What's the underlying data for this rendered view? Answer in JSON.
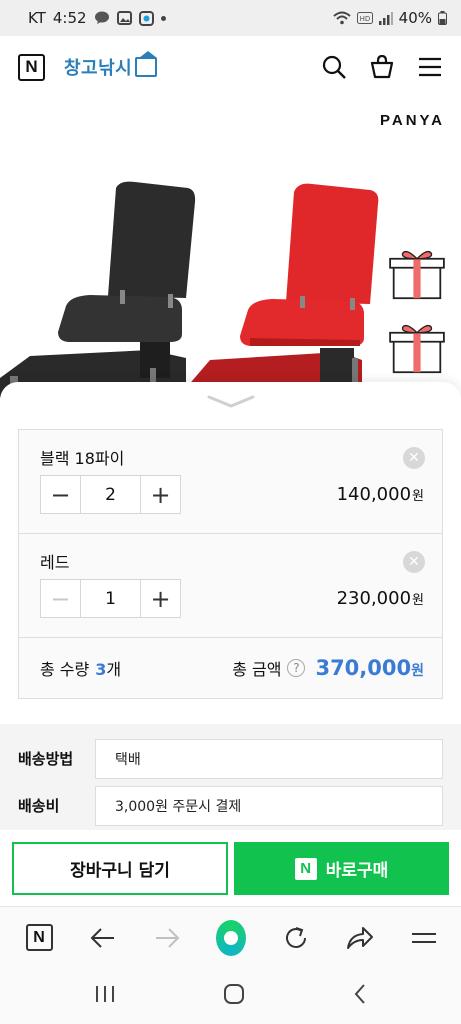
{
  "status_bar": {
    "carrier": "KT",
    "time": "4:52",
    "battery": "40%",
    "left_icons": [
      "chat-icon",
      "gallery-icon",
      "naver-icon"
    ],
    "right_icons": [
      "wifi-icon",
      "hd-icon",
      "signal-icon",
      "battery-icon"
    ]
  },
  "header": {
    "n_logo": "N",
    "store_name": "창고낚시",
    "icons": [
      "search-icon",
      "shopping-bag-icon",
      "menu-icon"
    ]
  },
  "hero": {
    "brand": "PANYA"
  },
  "options": [
    {
      "name": "블랙 18파이",
      "quantity": "2",
      "price": "140,000",
      "unit": "원"
    },
    {
      "name": "레드",
      "quantity": "1",
      "price": "230,000",
      "unit": "원"
    }
  ],
  "totals": {
    "count_label": "총 수량",
    "count": "3",
    "count_unit": "개",
    "amount_label": "총 금액",
    "help": "?",
    "amount": "370,000",
    "amount_unit": "원"
  },
  "shipping": {
    "method_label": "배송방법",
    "method_value": "택배",
    "fee_label": "배송비",
    "fee_value": "3,000원 주문시 결제"
  },
  "actions": {
    "cart_label": "장바구니 담기",
    "buy_icon": "N",
    "buy_label": "바로구매"
  },
  "browser_nav": {
    "n_logo": "N"
  },
  "colors": {
    "accent_green": "#12c24f",
    "accent_blue": "#3a7bd5",
    "store_blue": "#2a7fb8"
  }
}
